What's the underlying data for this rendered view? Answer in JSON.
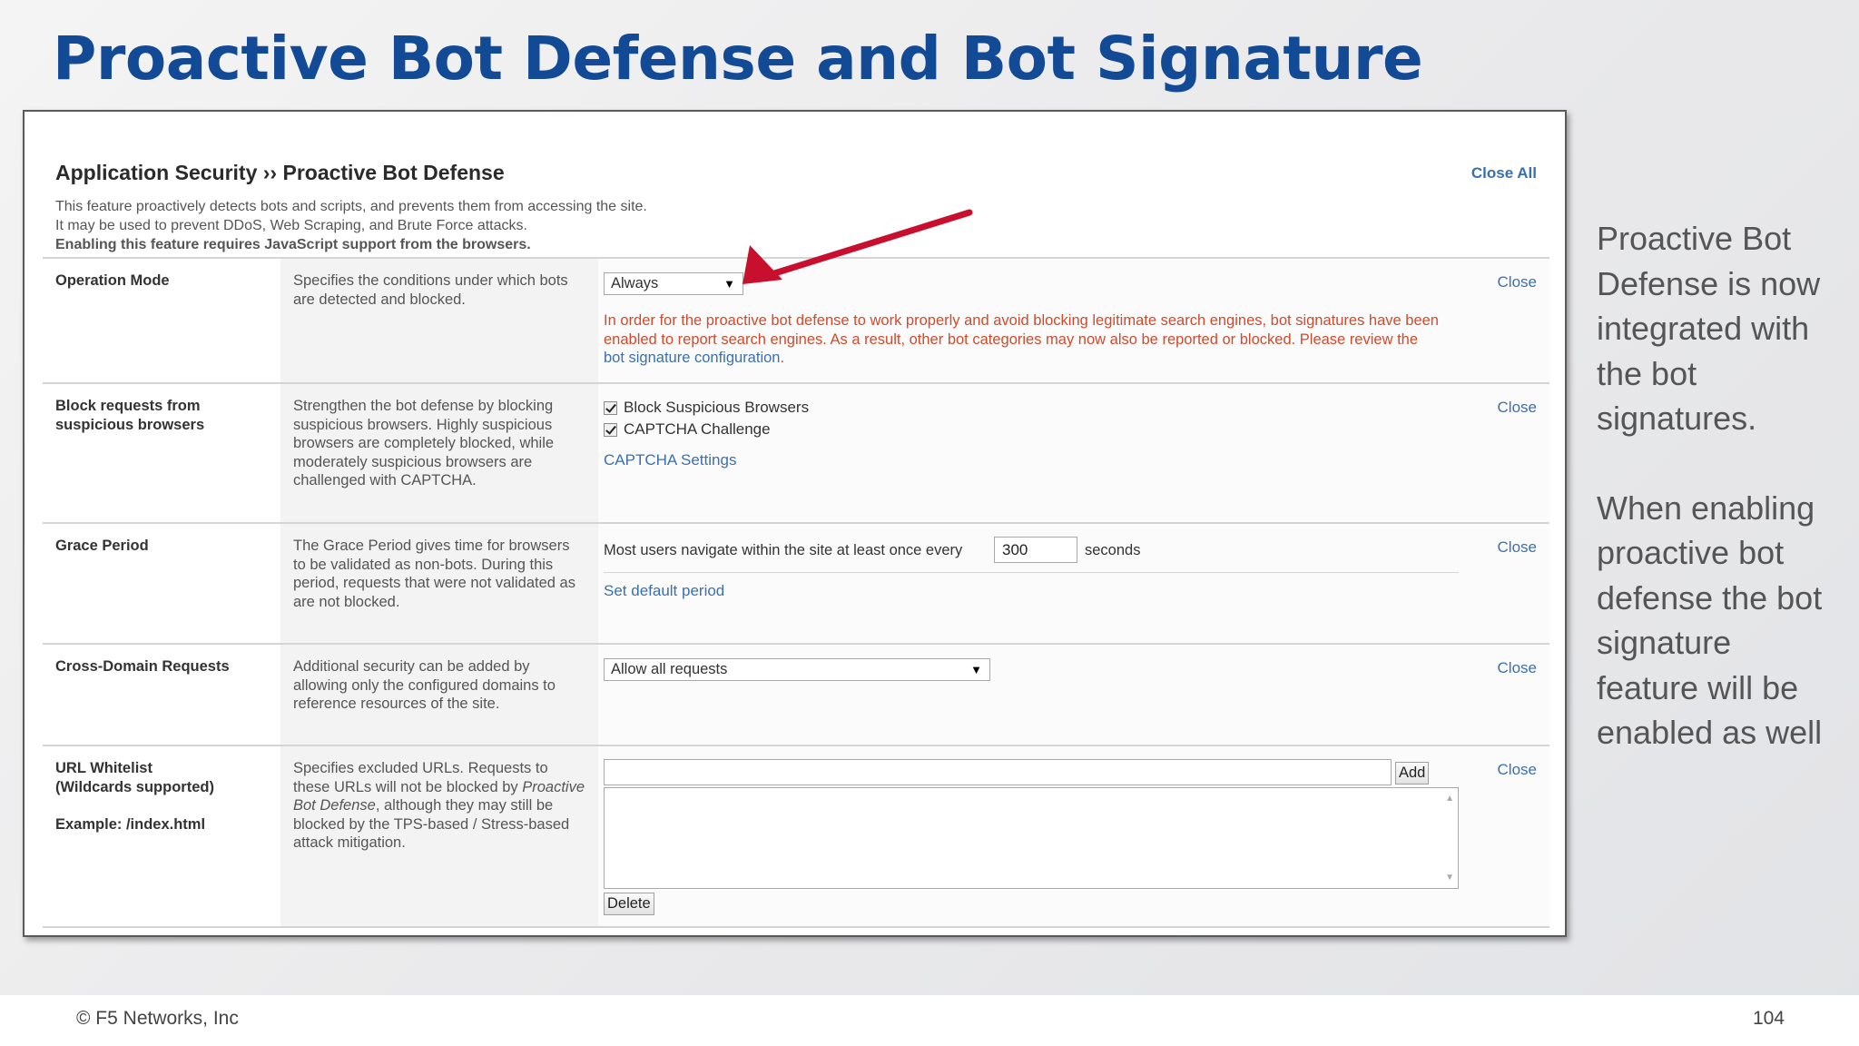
{
  "slide": {
    "title": "Proactive Bot Defense and Bot Signature",
    "side_paragraph_1": "Proactive Bot Defense is now integrated with the bot signatures.",
    "side_paragraph_2": "When enabling proactive bot defense the bot signature feature will be enabled as well",
    "copyright": "© F5 Networks, Inc",
    "page_number": "104"
  },
  "panel": {
    "title": "Application Security ›› Proactive Bot Defense",
    "close_all": "Close All",
    "description_line_1": "This feature proactively detects bots and scripts, and prevents them from accessing the site.",
    "description_line_2": "It may be used to prevent DDoS, Web Scraping, and Brute Force attacks.",
    "description_line_3": "Enabling this feature requires JavaScript support from the browsers."
  },
  "rows": {
    "operation_mode": {
      "label": "Operation Mode",
      "help": "Specifies the conditions under which bots are detected and blocked.",
      "select_value": "Always",
      "warning_text": "In order for the proactive bot defense to work properly and avoid blocking legitimate search engines, bot signatures have been enabled to report search engines. As a result, other bot categories may now also be reported or blocked. Please review the ",
      "warning_link": "bot signature configuration",
      "warning_end": ".",
      "close": "Close"
    },
    "block_requests": {
      "label": "Block requests from suspicious browsers",
      "help": "Strengthen the bot defense by blocking suspicious browsers. Highly suspicious browsers are completely blocked, while moderately suspicious browsers are challenged with CAPTCHA.",
      "checkbox_1": "Block Suspicious Browsers",
      "checkbox_2": "CAPTCHA Challenge",
      "captcha_link": "CAPTCHA Settings",
      "close": "Close"
    },
    "grace_period": {
      "label": "Grace Period",
      "help": "The Grace Period gives time for browsers to be validated as non-bots. During this period, requests that were not validated as are not blocked.",
      "prefix": "Most users navigate within the site at least once every",
      "value": "300",
      "suffix": "seconds",
      "default_link": "Set default period",
      "close": "Close"
    },
    "cross_domain": {
      "label": "Cross-Domain Requests",
      "help": "Additional security can be added by allowing only the configured domains to reference resources of the site.",
      "select_value": "Allow all requests",
      "close": "Close"
    },
    "url_whitelist": {
      "label_line_1": "URL Whitelist",
      "label_line_2": "(Wildcards supported)",
      "example": "Example: /index.html",
      "help_before": "Specifies excluded URLs. Requests to these URLs will not be blocked by ",
      "help_italic": "Proactive Bot Defense",
      "help_after": ", although they may still be blocked by the TPS-based / Stress-based attack mitigation.",
      "input_value": "",
      "add_button": "Add",
      "delete_button": "Delete",
      "close": "Close"
    }
  },
  "colors": {
    "title_blue": "#124a96",
    "link_blue": "#3a6fb0",
    "warning_red": "#d14a2b",
    "arrow_red": "#c8102e"
  },
  "icons": {
    "dropdown": "triangle-down-icon",
    "checkbox": "checkmark-icon",
    "annotation_arrow": "red-arrow-icon"
  }
}
